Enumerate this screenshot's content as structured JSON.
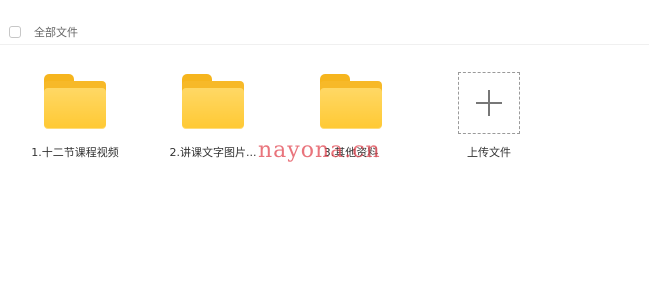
{
  "topbar": {
    "nav_back": "‹",
    "nav_forward": "›",
    "nav_refresh": "↻",
    "crumb_1": "",
    "crumb_2": "",
    "crumb_3": ""
  },
  "header": {
    "select_all_label": "全部文件"
  },
  "items": [
    {
      "label": "1.十二节课程视频",
      "icon": "folder-icon"
    },
    {
      "label": "2.讲课文字图片...",
      "icon": "folder-icon"
    },
    {
      "label": "3.其他资料",
      "icon": "folder-icon"
    }
  ],
  "upload": {
    "label": "上传文件",
    "icon": "plus-icon"
  },
  "watermark": {
    "text": "nayona.cn"
  },
  "colors": {
    "folder_front": "#ffc933",
    "folder_back": "#f7b928",
    "watermark": "#e24650"
  }
}
